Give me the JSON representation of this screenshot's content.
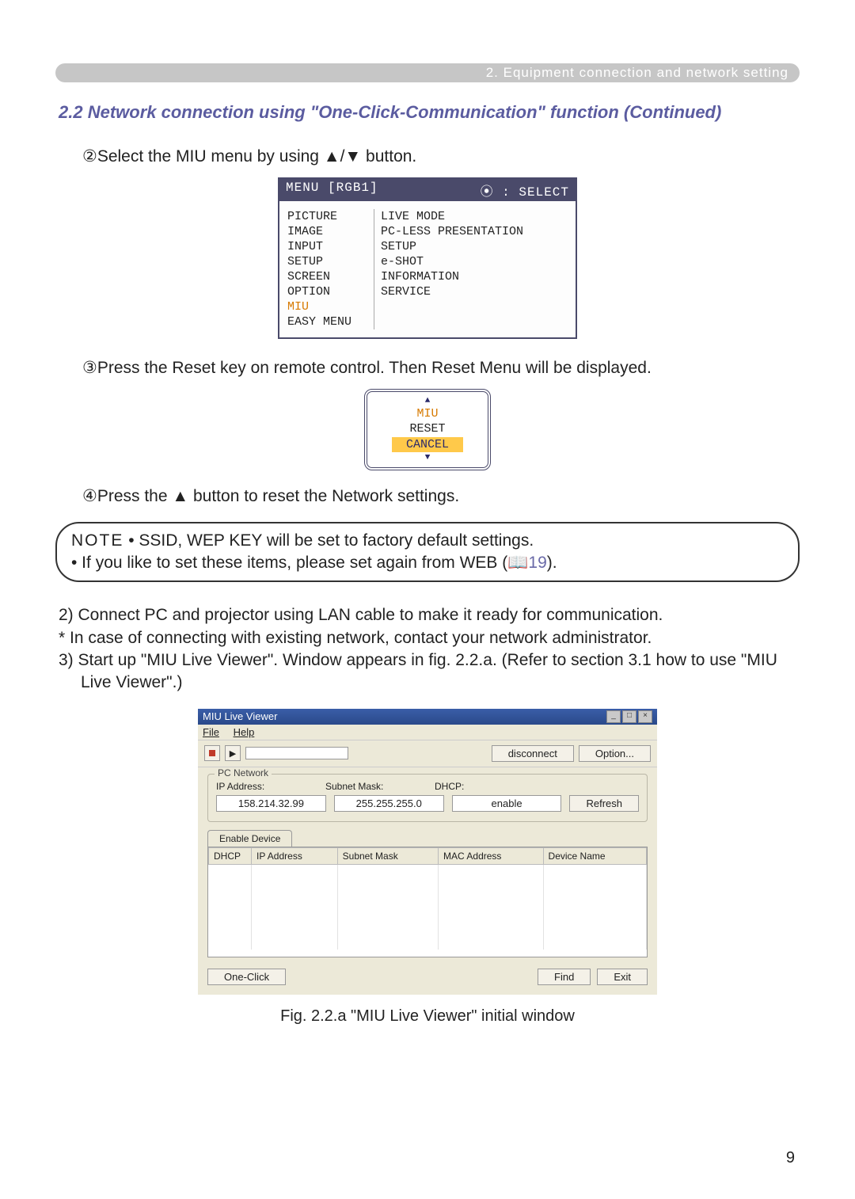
{
  "header": {
    "section_label": "2. Equipment connection and network setting"
  },
  "title": "2.2 Network connection using \"One-Click-Communication\" function (Continued)",
  "step2": "②Select the MIU menu by using ▲/▼ button.",
  "osd": {
    "title_left": "MENU [RGB1]",
    "title_right": "⦿ : SELECT",
    "left_items": [
      "PICTURE",
      "IMAGE",
      "INPUT",
      "SETUP",
      "SCREEN",
      "OPTION"
    ],
    "miu": "MIU",
    "easy_menu": "EASY MENU",
    "right_items": [
      "LIVE MODE",
      "PC-LESS PRESENTATION",
      "SETUP",
      "e-SHOT",
      "INFORMATION",
      "SERVICE"
    ]
  },
  "step3": "③Press the Reset key on remote control. Then Reset Menu will be displayed.",
  "reset": {
    "miu": "MIU",
    "reset": "RESET",
    "cancel": "CANCEL"
  },
  "step4": "④Press the ▲ button to reset the Network settings.",
  "note": {
    "label": "NOTE",
    "line1": "• SSID, WEP KEY will be set to factory default settings.",
    "line2_a": "• If you like to set these items, please set again from WEB (",
    "ref": "📖19",
    "line2_b": ")."
  },
  "steps_after": {
    "s2": "2) Connect PC and projector using LAN cable to make it ready for communication.",
    "s2b": "* In case of connecting with existing network, contact your network administrator.",
    "s3": "3) Start up \"MIU Live Viewer\". Window appears in fig. 2.2.a. (Refer to section 3.1 how to use \"MIU Live Viewer\".)"
  },
  "viewer": {
    "title": "MIU Live Viewer",
    "menus": {
      "file": "File",
      "help": "Help"
    },
    "play_icon": "▶",
    "disconnect": "disconnect",
    "option": "Option...",
    "pc_network": {
      "group": "PC Network",
      "ip_label": "IP Address:",
      "mask_label": "Subnet Mask:",
      "dhcp_label": "DHCP:",
      "ip": "158.214.32.99",
      "mask": "255.255.255.0",
      "dhcp": "enable",
      "refresh": "Refresh"
    },
    "tab": "Enable Device",
    "cols": {
      "dhcp": "DHCP",
      "ip": "IP Address",
      "mask": "Subnet Mask",
      "mac": "MAC Address",
      "name": "Device Name"
    },
    "one_click": "One-Click",
    "find": "Find",
    "exit": "Exit"
  },
  "caption": "Fig. 2.2.a \"MIU Live Viewer\" initial window",
  "page_number": "9"
}
